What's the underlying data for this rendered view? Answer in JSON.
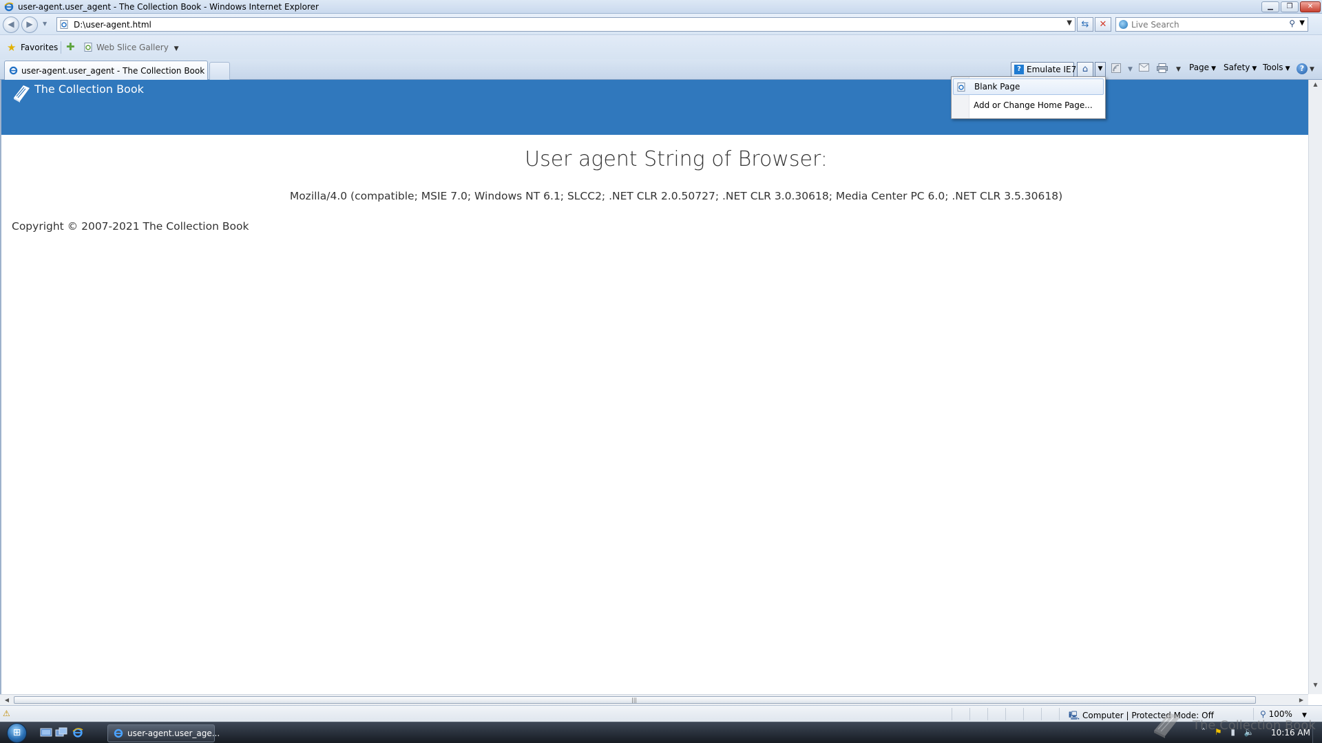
{
  "window": {
    "title": "user-agent.user_agent - The Collection Book - Windows Internet Explorer"
  },
  "address_bar": {
    "url": "D:\\user-agent.html"
  },
  "search": {
    "placeholder": "Live Search"
  },
  "favorites_bar": {
    "favorites_label": "Favorites",
    "web_slice_gallery_label": "Web Slice Gallery"
  },
  "tabs": [
    {
      "label": "user-agent.user_agent - The Collection Book"
    }
  ],
  "command_bar": {
    "emulate_label": "Emulate IE7",
    "page_label": "Page",
    "safety_label": "Safety",
    "tools_label": "Tools"
  },
  "home_menu": {
    "items": [
      {
        "label": "Blank Page"
      },
      {
        "label": "Add or Change Home Page..."
      }
    ]
  },
  "page": {
    "brand": "The Collection Book",
    "heading": "User agent String of Browser:",
    "user_agent": "Mozilla/4.0 (compatible; MSIE 7.0; Windows NT 6.1; SLCC2; .NET CLR 2.0.50727; .NET CLR 3.0.30618; Media Center PC 6.0; .NET CLR 3.5.30618)",
    "copyright": "Copyright © 2007-2021 The Collection Book"
  },
  "status_bar": {
    "zone": "Computer | Protected Mode: Off",
    "zoom": "100%"
  },
  "taskbar": {
    "ie_task_label": "user-agent.user_age...",
    "clock": "10:16 AM"
  },
  "watermark": {
    "text": "The Collection Book"
  },
  "colors": {
    "banner": "#3078bd",
    "ie_blue": "#1f6fc4"
  }
}
